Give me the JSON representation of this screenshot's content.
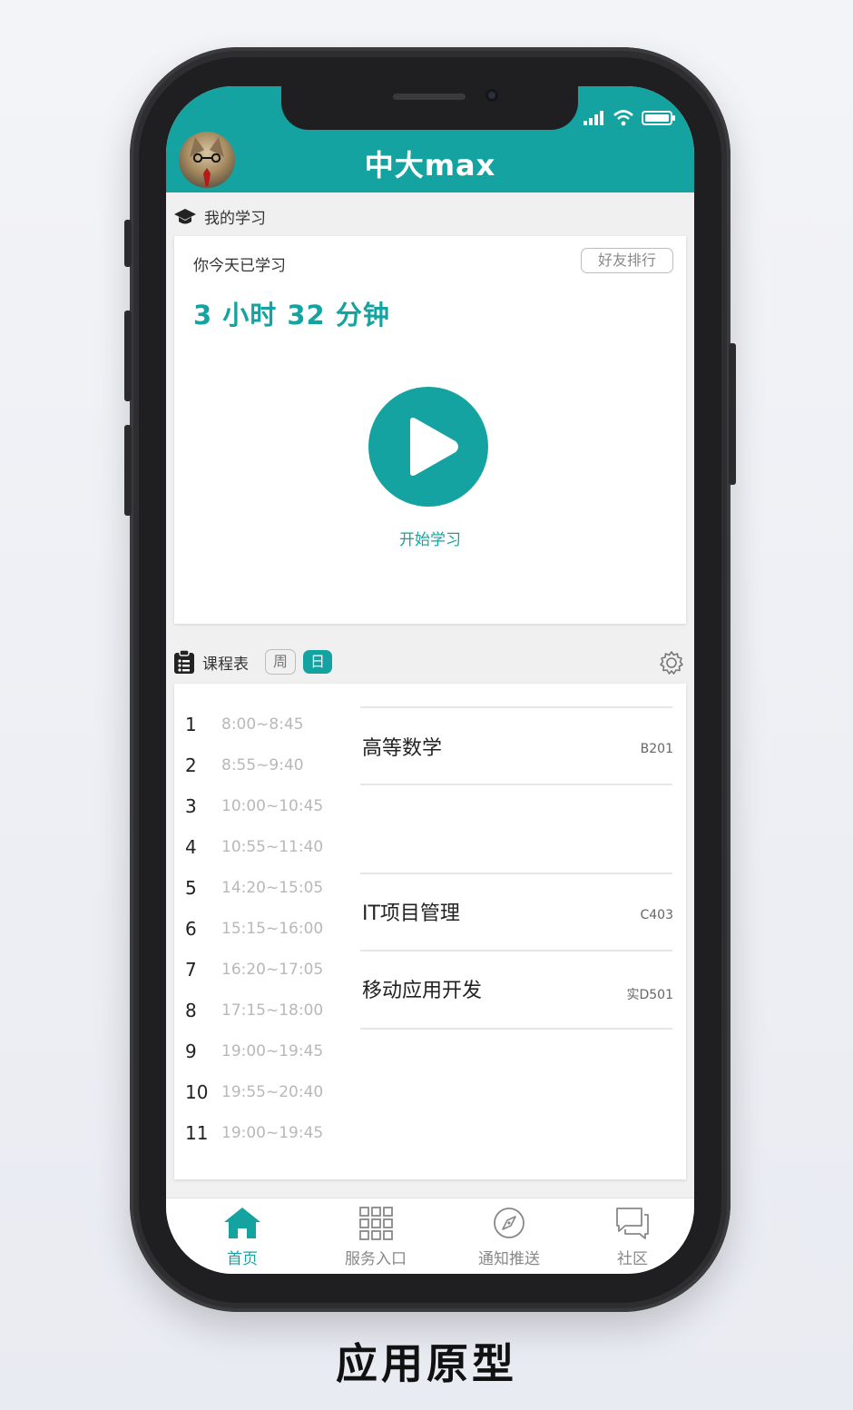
{
  "header": {
    "title": "中大max"
  },
  "my_study": {
    "section_label": "我的学习",
    "today_label": "你今天已学习",
    "rank_button": "好友排行",
    "study_time": "3 小时 32 分钟",
    "start_label": "开始学习"
  },
  "schedule": {
    "section_label": "课程表",
    "toggle_week": "周",
    "toggle_day": "日",
    "periods": [
      {
        "num": "1",
        "time": "8:00~8:45"
      },
      {
        "num": "2",
        "time": "8:55~9:40"
      },
      {
        "num": "3",
        "time": "10:00~10:45"
      },
      {
        "num": "4",
        "time": "10:55~11:40"
      },
      {
        "num": "5",
        "time": "14:20~15:05"
      },
      {
        "num": "6",
        "time": "15:15~16:00"
      },
      {
        "num": "7",
        "time": "16:20~17:05"
      },
      {
        "num": "8",
        "time": "17:15~18:00"
      },
      {
        "num": "9",
        "time": "19:00~19:45"
      },
      {
        "num": "10",
        "time": "19:55~20:40"
      },
      {
        "num": "11",
        "time": "19:00~19:45"
      }
    ],
    "courses": [
      {
        "name": "高等数学",
        "room": "B201"
      },
      {
        "name": "IT项目管理",
        "room": "C403"
      },
      {
        "name": "移动应用开发",
        "room": "实D501"
      }
    ]
  },
  "tabbar": {
    "items": [
      {
        "label": "首页",
        "icon": "home-icon",
        "active": true
      },
      {
        "label": "服务入口",
        "icon": "grid-icon",
        "active": false
      },
      {
        "label": "通知推送",
        "icon": "compass-icon",
        "active": false
      },
      {
        "label": "社区",
        "icon": "chat-icon",
        "active": false
      }
    ]
  },
  "caption": "应用原型",
  "colors": {
    "accent": "#15a3a1",
    "background": "#f0f0f0"
  }
}
